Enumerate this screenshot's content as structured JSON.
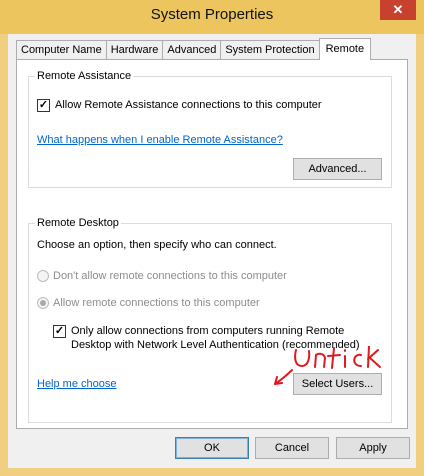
{
  "window": {
    "title": "System Properties",
    "close_icon": "close-icon",
    "close_glyph": "✕"
  },
  "tabs": [
    {
      "label": "Computer Name"
    },
    {
      "label": "Hardware"
    },
    {
      "label": "Advanced"
    },
    {
      "label": "System Protection"
    },
    {
      "label": "Remote",
      "active": true
    }
  ],
  "remote_assistance": {
    "group_title": "Remote Assistance",
    "allow_label": "Allow Remote Assistance connections to this computer",
    "allow_checked": true,
    "help_link": "What happens when I enable Remote Assistance?",
    "advanced_button": "Advanced..."
  },
  "remote_desktop": {
    "group_title": "Remote Desktop",
    "instruction": "Choose an option, then specify who can connect.",
    "option_dont_allow": "Don't allow remote connections to this computer",
    "option_allow": "Allow remote connections to this computer",
    "selected_option": "allow",
    "nla_label_line1": "Only allow connections from computers running Remote",
    "nla_label_line2": "Desktop with Network Level Authentication (recommended)",
    "nla_checked": true,
    "help_link": "Help me choose",
    "select_users_button": "Select Users..."
  },
  "annotation": {
    "text": "Untick",
    "color": "#e0191f"
  },
  "footer": {
    "ok_button": "OK",
    "cancel_button": "Cancel",
    "apply_button": "Apply"
  }
}
